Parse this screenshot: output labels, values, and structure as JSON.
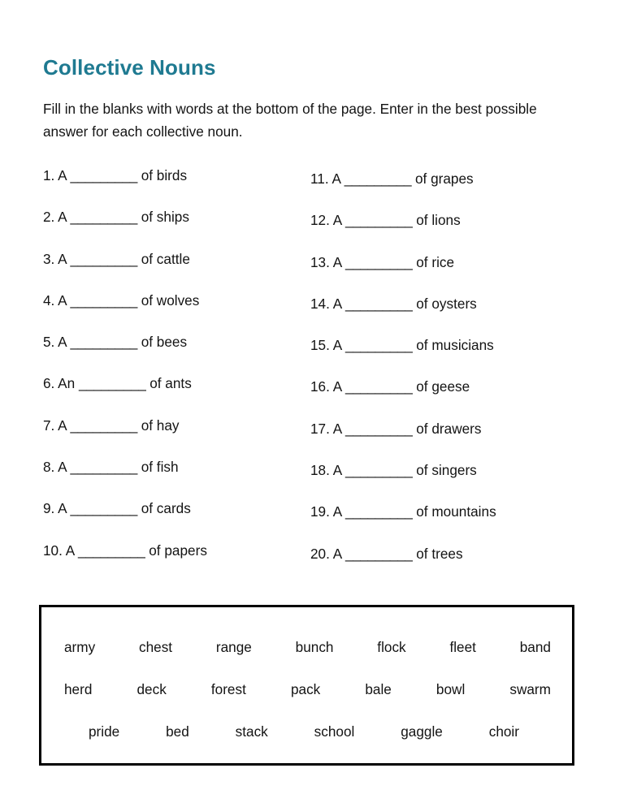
{
  "worksheet": {
    "title": "Collective Nouns",
    "instructions": "Fill in the blanks with words at the bottom of the page. Enter in the best possible answer for each collective noun.",
    "blank_placeholder": "_________"
  },
  "questions": {
    "left_column": [
      {
        "number": "1.",
        "article": "A",
        "blank": "_________",
        "tail": "of birds"
      },
      {
        "number": "2.",
        "article": "A",
        "blank": "_________",
        "tail": "of ships"
      },
      {
        "number": "3.",
        "article": "A",
        "blank": "_________",
        "tail": "of cattle"
      },
      {
        "number": "4.",
        "article": "A",
        "blank": "_________",
        "tail": "of wolves"
      },
      {
        "number": "5.",
        "article": "A",
        "blank": "_________",
        "tail": "of bees"
      },
      {
        "number": "6.",
        "article": "An",
        "blank": "_________",
        "tail": "of ants"
      },
      {
        "number": "7.",
        "article": "A",
        "blank": "_________",
        "tail": "of hay"
      },
      {
        "number": "8.",
        "article": "A",
        "blank": "_________",
        "tail": "of fish"
      },
      {
        "number": "9.",
        "article": "A",
        "blank": "_________",
        "tail": "of cards"
      },
      {
        "number": "10.",
        "article": "A",
        "blank": "_________",
        "tail": "of papers"
      }
    ],
    "right_column": [
      {
        "number": "11.",
        "article": "A",
        "blank": "_________",
        "tail": "of grapes"
      },
      {
        "number": "12.",
        "article": "A",
        "blank": "_________",
        "tail": "of lions"
      },
      {
        "number": "13.",
        "article": "A",
        "blank": "_________",
        "tail": "of rice"
      },
      {
        "number": "14.",
        "article": "A",
        "blank": "_________",
        "tail": "of oysters"
      },
      {
        "number": "15.",
        "article": "A",
        "blank": "_________",
        "tail": "of musicians"
      },
      {
        "number": "16.",
        "article": "A",
        "blank": "_________",
        "tail": "of geese"
      },
      {
        "number": "17.",
        "article": "A",
        "blank": "_________",
        "tail": "of drawers"
      },
      {
        "number": "18.",
        "article": "A",
        "blank": "_________",
        "tail": "of singers"
      },
      {
        "number": "19.",
        "article": "A",
        "blank": "_________",
        "tail": "of mountains"
      },
      {
        "number": "20.",
        "article": "A",
        "blank": "_________",
        "tail": "of trees"
      }
    ]
  },
  "word_bank": {
    "rows": [
      [
        "army",
        "chest",
        "range",
        "bunch",
        "flock",
        "fleet",
        "band"
      ],
      [
        "herd",
        "deck",
        "forest",
        "pack",
        "bale",
        "bowl",
        "swarm"
      ],
      [
        "pride",
        "bed",
        "stack",
        "school",
        "gaggle",
        "choir"
      ]
    ]
  },
  "colors": {
    "title": "#1f7a91",
    "text": "#141414",
    "word_bank_border": "#000000",
    "page_background": "#ffffff"
  }
}
